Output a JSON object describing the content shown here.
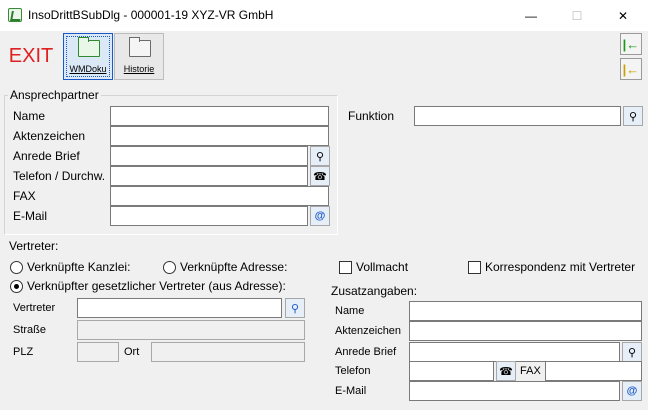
{
  "window": {
    "title": "InsoDrittBSubDlg - 000001-19 XYZ-VR GmbH",
    "minimize_glyph": "—",
    "maximize_glyph": "☐",
    "close_glyph": "✕"
  },
  "toolbar": {
    "exit_label": "EXIT",
    "wmdoku_label": "WMDoku",
    "historie_label": "Historie",
    "nav_first_icon": "arrow-left-first-icon",
    "nav_prev_icon": "arrow-left-prev-icon"
  },
  "ansprechpartner": {
    "caption": "Ansprechpartner",
    "name_label": "Name",
    "aktenzeichen_label": "Aktenzeichen",
    "anrede_label": "Anrede Brief",
    "telefon_label": "Telefon / Durchw.",
    "fax_label": "FAX",
    "email_label": "E-Mail",
    "funktion_label": "Funktion",
    "name_value": "",
    "aktenzeichen_value": "",
    "anrede_value": "",
    "telefon_value": "",
    "fax_value": "",
    "email_value": "",
    "funktion_value": ""
  },
  "vertreter": {
    "caption": "Vertreter:",
    "radio_kanzlei": "Verknüpfte Kanzlei:",
    "radio_adresse": "Verknüpfte Adresse:",
    "check_vollmacht": "Vollmacht",
    "check_korrespondenz": "Korrespondenz mit Vertreter",
    "radio_gesetzlich": "Verknüpfter gesetzlicher Vertreter (aus Adresse):",
    "vertreter_label": "Vertreter",
    "strasse_label": "Straße",
    "plz_label": "PLZ",
    "ort_label": "Ort",
    "vertreter_value": "",
    "strasse_value": "",
    "plz_value": "",
    "ort_value": ""
  },
  "zusatz": {
    "caption": "Zusatzangaben:",
    "name_label": "Name",
    "aktenzeichen_label": "Aktenzeichen",
    "anrede_label": "Anrede Brief",
    "telefon_label": "Telefon",
    "fax_label": "FAX",
    "email_label": "E-Mail",
    "name_value": "",
    "aktenzeichen_value": "",
    "anrede_value": "",
    "telefon_value": "",
    "fax_value": "",
    "email_value": ""
  },
  "colors": {
    "exit": "#e02020",
    "nav_green": "#1a9a1a",
    "nav_yellow": "#c8a000",
    "focus_border": "#1a58c8"
  }
}
